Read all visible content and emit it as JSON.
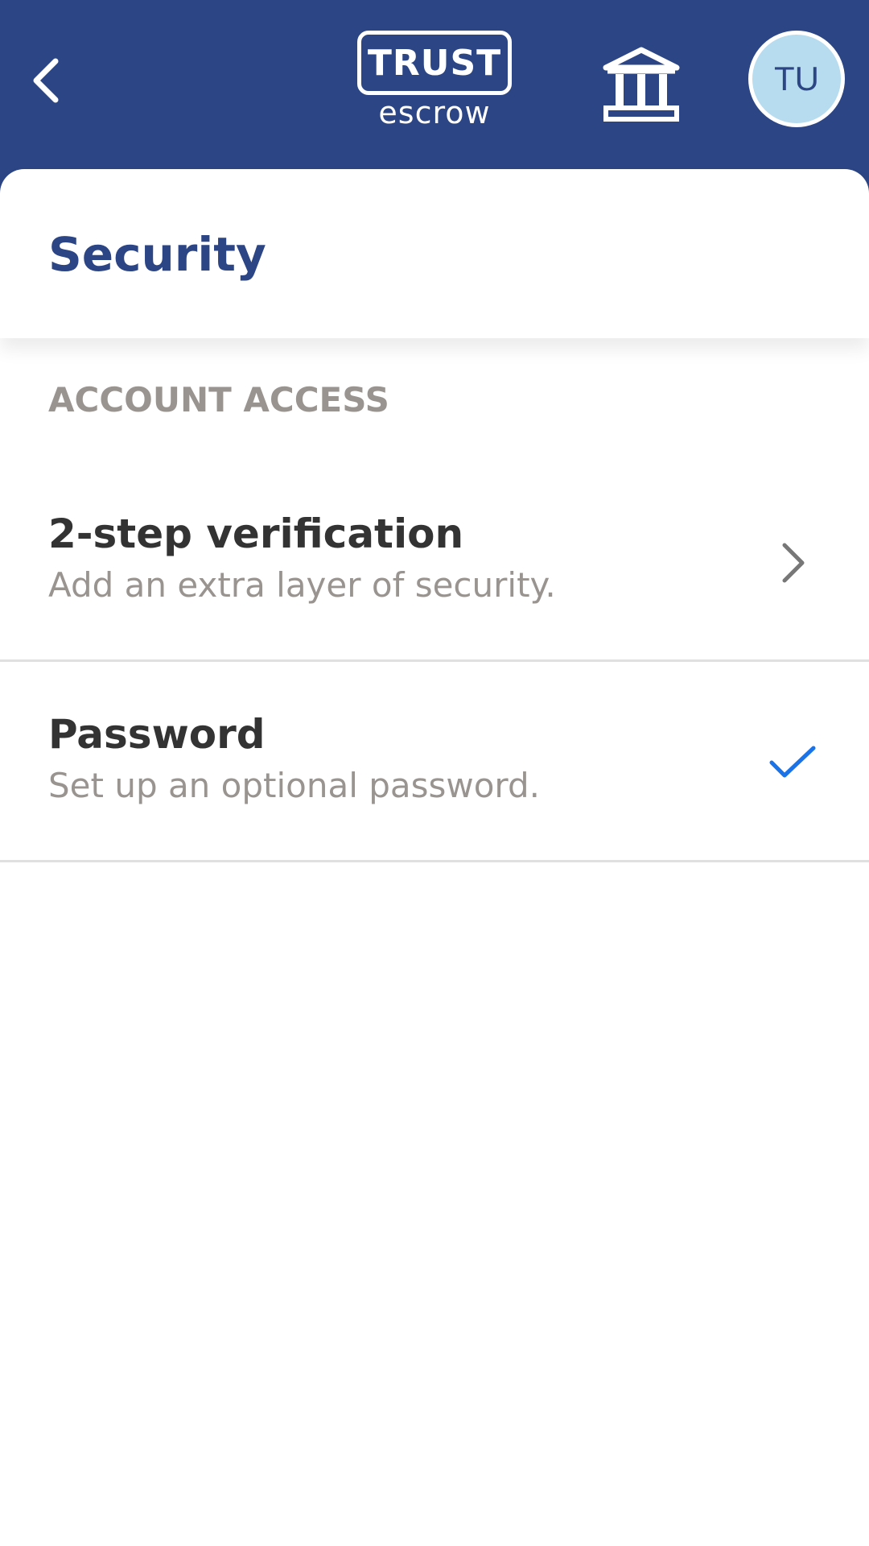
{
  "header": {
    "logo_main": "TRUST",
    "logo_sub": "escrow",
    "back_icon": "chevron-left-icon",
    "bank_icon": "bank-icon",
    "avatar_initials": "TU",
    "bar_color": "#2c4585",
    "avatar_color": "#b7dcef"
  },
  "page": {
    "title": "Security",
    "title_color": "#2c4585"
  },
  "section": {
    "label": "ACCOUNT ACCESS",
    "items": [
      {
        "title": "2-step verification",
        "subtitle": "Add an extra layer of security.",
        "trailing_icon": "chevron-right-icon"
      },
      {
        "title": "Password",
        "subtitle": "Set up an optional password.",
        "trailing_icon": "checkmark-icon",
        "checked": true,
        "check_color": "#1a73e8"
      }
    ]
  }
}
